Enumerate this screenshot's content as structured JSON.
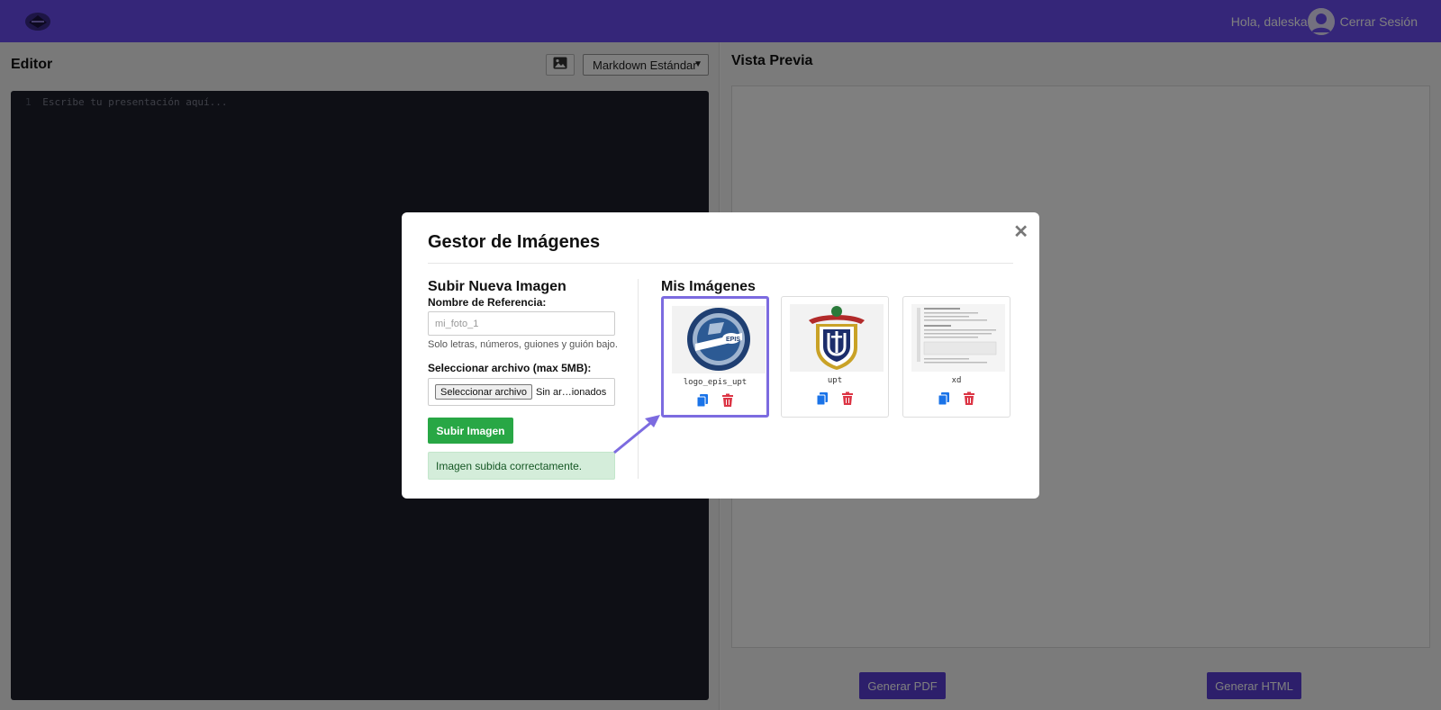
{
  "header": {
    "greeting": "Hola, daleska",
    "logout_label": "Cerrar Sesión",
    "accent_color": "#6b4df2"
  },
  "editor": {
    "title": "Editor",
    "mode_selected": "Markdown Estándar",
    "line_number": "1",
    "placeholder": "Escribe tu presentación aquí..."
  },
  "preview": {
    "title": "Vista Previa",
    "pdf_button": "Generar PDF",
    "html_button": "Generar HTML"
  },
  "modal": {
    "title": "Gestor de Imágenes",
    "close_icon": "close-icon",
    "upload": {
      "title": "Subir Nueva Imagen",
      "ref_label": "Nombre de Referencia:",
      "ref_placeholder": "mi_foto_1",
      "ref_hint": "Solo letras, números, guiones y guión bajo.",
      "file_label": "Seleccionar archivo (max 5MB):",
      "file_button": "Seleccionar archivo",
      "file_status": "Sin ar…ionados",
      "submit_label": "Subir Imagen",
      "success_message": "Imagen subida correctamente."
    },
    "gallery": {
      "title": "Mis Imágenes",
      "items": [
        {
          "name": "logo_epis_upt",
          "selected": true
        },
        {
          "name": "upt",
          "selected": false
        },
        {
          "name": "xd",
          "selected": false
        }
      ]
    }
  }
}
